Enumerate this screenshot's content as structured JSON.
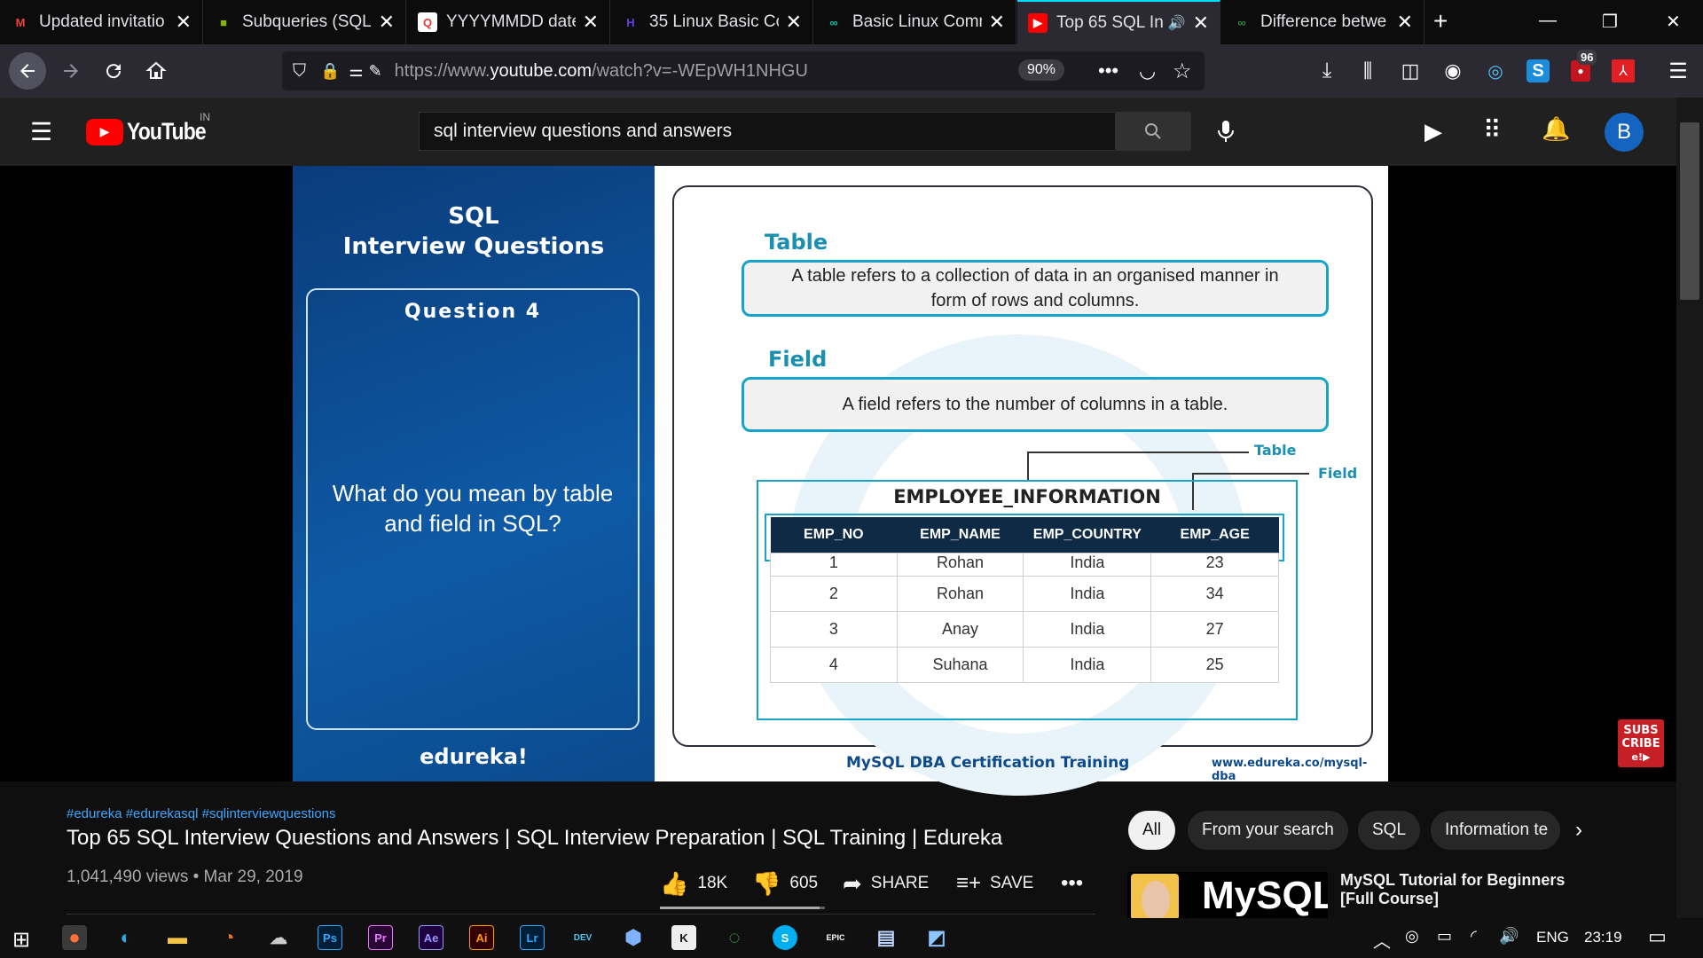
{
  "browser": {
    "tabs": [
      {
        "title": "Updated invitatio",
        "icon": "gmail-icon",
        "fav": "M",
        "fav_color": "#ea4335",
        "fav_bg": "transparent"
      },
      {
        "title": "Subqueries (SQL",
        "icon": "microsoft-icon",
        "fav": "■",
        "fav_color": "#7fba00",
        "fav_bg": "transparent"
      },
      {
        "title": "YYYYMMDD date",
        "icon": "page-icon",
        "fav": "Q",
        "fav_color": "#e53935",
        "fav_bg": "#fff"
      },
      {
        "title": "35 Linux Basic Co",
        "icon": "hostinger-icon",
        "fav": "H",
        "fav_color": "#673de6",
        "fav_bg": "transparent"
      },
      {
        "title": "Basic Linux Comm",
        "icon": "site-icon",
        "fav": "∞",
        "fav_color": "#00c2a8",
        "fav_bg": "transparent"
      },
      {
        "title": "Top 65 SQL In",
        "icon": "youtube-icon",
        "fav": "▶",
        "fav_color": "#fff",
        "fav_bg": "#ff0000",
        "active": true
      },
      {
        "title": "Difference betwe",
        "icon": "site-icon",
        "fav": "∞",
        "fav_color": "#2f8d46",
        "fav_bg": "transparent"
      }
    ],
    "url_prefix": "https://www.",
    "url_domain": "youtube.com",
    "url_path": "/watch?v=-WEpWH1NHGU",
    "zoom": "90%",
    "extension_badge": "96"
  },
  "youtube": {
    "logo_text": "YouTube",
    "region": "IN",
    "search_query": "sql interview questions and answers",
    "avatar_letter": "B"
  },
  "slide": {
    "left_title_1": "SQL",
    "left_title_2": "Interview Questions",
    "question_label": "Question 4",
    "question_text": "What do you mean by table and field in SQL?",
    "brand": "edureka!",
    "table_heading": "Table",
    "table_def": "A table refers to a collection of data in an organised manner in form of rows and columns.",
    "field_heading": "Field",
    "field_def": "A field refers to the number of columns in a table.",
    "callout_table": "Table",
    "callout_field": "Field",
    "table_name": "EMPLOYEE_INFORMATION",
    "columns": [
      "EMP_NO",
      "EMP_NAME",
      "EMP_COUNTRY",
      "EMP_AGE"
    ],
    "rows": [
      [
        "1",
        "Rohan",
        "India",
        "23"
      ],
      [
        "2",
        "Rohan",
        "India",
        "34"
      ],
      [
        "3",
        "Anay",
        "India",
        "27"
      ],
      [
        "4",
        "Suhana",
        "India",
        "25"
      ]
    ],
    "footer_course": "MySQL DBA Certification Training",
    "footer_url": "www.edureka.co/mysql-dba",
    "subscribe_1": "SUBS",
    "subscribe_2": "CRIBE",
    "subscribe_3": "e!▶"
  },
  "video": {
    "hashtags": "#edureka #edurekasql #sqlinterviewquestions",
    "title": "Top 65 SQL Interview Questions and Answers | SQL Interview Preparation | SQL Training | Edureka",
    "views": "1,041,490 views",
    "date": "Mar 29, 2019",
    "likes": "18K",
    "dislikes": "605",
    "share": "SHARE",
    "save": "SAVE"
  },
  "chips": [
    "All",
    "From your search",
    "SQL",
    "Information te"
  ],
  "recommendation": {
    "thumb_text": "MySQL",
    "title_1": "MySQL Tutorial for Beginners",
    "title_2": "[Full Course]"
  },
  "taskbar": {
    "language": "ENG",
    "time": "23:19"
  }
}
